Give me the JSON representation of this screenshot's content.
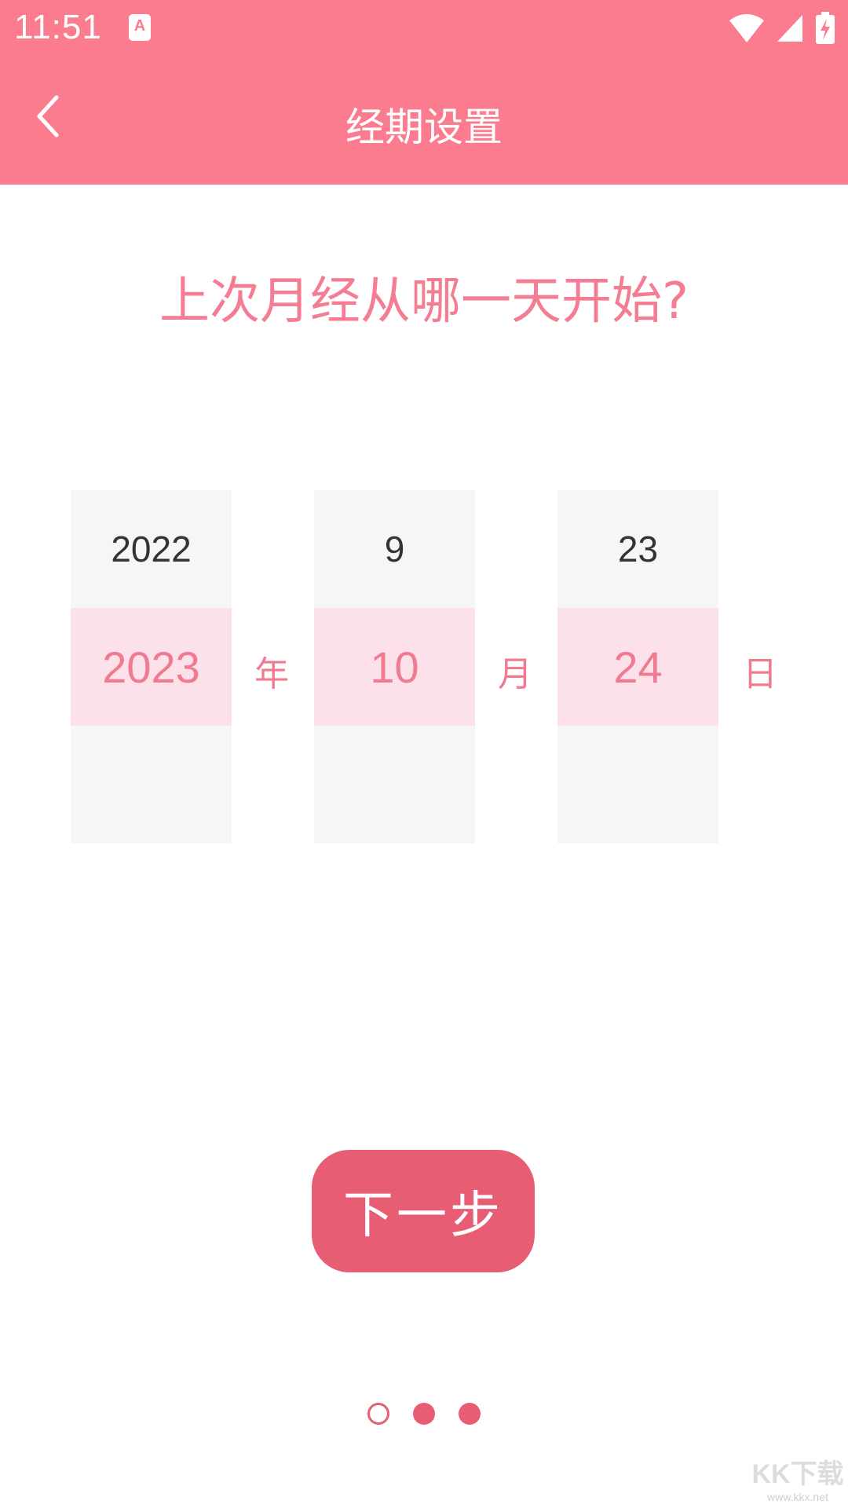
{
  "status_bar": {
    "time": "11:51",
    "notification_letter": "A",
    "icons": [
      "wifi-icon",
      "signal-icon",
      "battery-charging-icon"
    ]
  },
  "header": {
    "title": "经期设置",
    "back_icon": "chevron-left-icon"
  },
  "question": "上次月经从哪一天开始?",
  "picker": {
    "year": {
      "prev": "2022",
      "selected": "2023",
      "next": "",
      "unit": "年"
    },
    "month": {
      "prev": "9",
      "selected": "10",
      "next": "",
      "unit": "月"
    },
    "day": {
      "prev": "23",
      "selected": "24",
      "next": "",
      "unit": "日"
    }
  },
  "next_button": {
    "label": "下一步"
  },
  "page_indicator": {
    "count": 3,
    "current": 1
  },
  "watermark": {
    "main": "KK下载",
    "sub": "www.kkx.net"
  },
  "colors": {
    "header_bg": "#fb7b8f",
    "accent": "#e65d74",
    "text_pink": "#f07a90",
    "selected_bg": "#fde1ea",
    "column_bg": "#f6f6f6"
  }
}
